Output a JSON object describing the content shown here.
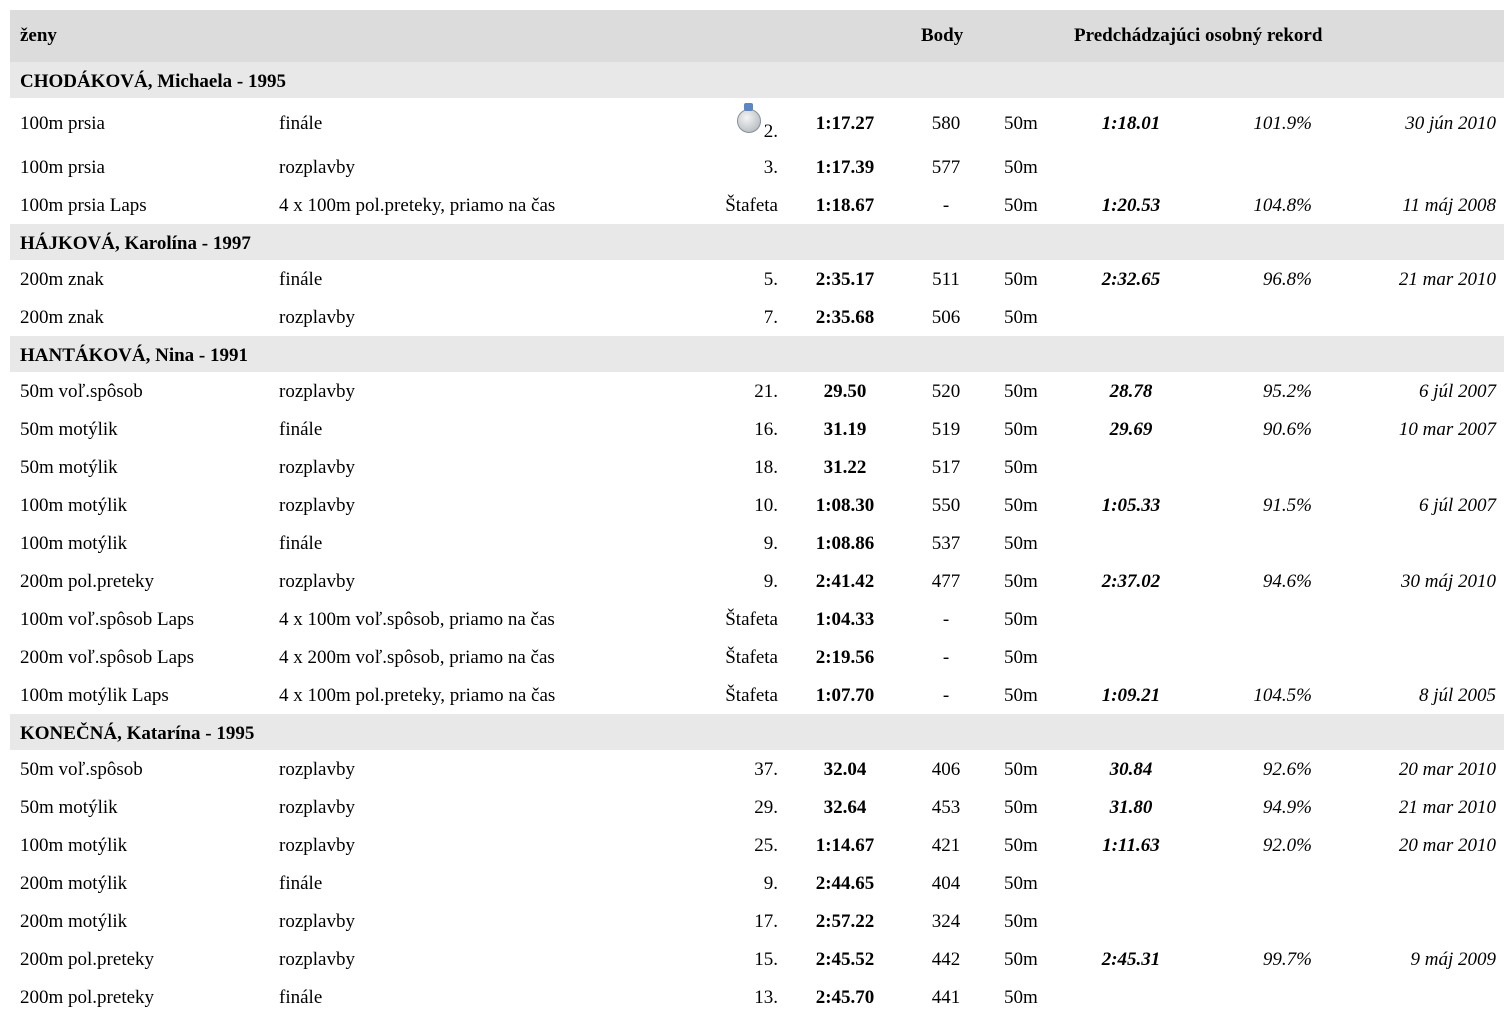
{
  "header": {
    "gender": "ženy",
    "points": "Body",
    "prev_record": "Predchádzajúci osobný rekord"
  },
  "athletes": [
    {
      "name": "CHODÁKOVÁ, Michaela - 1995",
      "results": [
        {
          "event": "100m prsia",
          "round": "finále",
          "place": "2.",
          "medal": "silver-medal",
          "time": "1:17.27",
          "points": "580",
          "pool": "50m",
          "prev": "1:18.01",
          "pct": "101.9%",
          "date": "30 jún 2010"
        },
        {
          "event": "100m prsia",
          "round": "rozplavby",
          "place": "3.",
          "time": "1:17.39",
          "points": "577",
          "pool": "50m",
          "prev": "",
          "pct": "",
          "date": ""
        },
        {
          "event": "100m prsia Laps",
          "round": "4 x 100m pol.preteky, priamo na čas",
          "place": "Štafeta",
          "time": "1:18.67",
          "points": "-",
          "pool": "50m",
          "prev": "1:20.53",
          "pct": "104.8%",
          "date": "11 máj 2008"
        }
      ]
    },
    {
      "name": "HÁJKOVÁ, Karolína - 1997",
      "results": [
        {
          "event": "200m znak",
          "round": "finále",
          "place": "5.",
          "time": "2:35.17",
          "points": "511",
          "pool": "50m",
          "prev": "2:32.65",
          "pct": "96.8%",
          "date": "21 mar 2010"
        },
        {
          "event": "200m znak",
          "round": "rozplavby",
          "place": "7.",
          "time": "2:35.68",
          "points": "506",
          "pool": "50m",
          "prev": "",
          "pct": "",
          "date": ""
        }
      ]
    },
    {
      "name": "HANTÁKOVÁ, Nina - 1991",
      "results": [
        {
          "event": "50m voľ.spôsob",
          "round": "rozplavby",
          "place": "21.",
          "time": "29.50",
          "points": "520",
          "pool": "50m",
          "prev": "28.78",
          "pct": "95.2%",
          "date": "6 júl 2007"
        },
        {
          "event": "50m motýlik",
          "round": "finále",
          "place": "16.",
          "time": "31.19",
          "points": "519",
          "pool": "50m",
          "prev": "29.69",
          "pct": "90.6%",
          "date": "10 mar 2007"
        },
        {
          "event": "50m motýlik",
          "round": "rozplavby",
          "place": "18.",
          "time": "31.22",
          "points": "517",
          "pool": "50m",
          "prev": "",
          "pct": "",
          "date": ""
        },
        {
          "event": "100m motýlik",
          "round": "rozplavby",
          "place": "10.",
          "time": "1:08.30",
          "points": "550",
          "pool": "50m",
          "prev": "1:05.33",
          "pct": "91.5%",
          "date": "6 júl 2007"
        },
        {
          "event": "100m motýlik",
          "round": "finále",
          "place": "9.",
          "time": "1:08.86",
          "points": "537",
          "pool": "50m",
          "prev": "",
          "pct": "",
          "date": ""
        },
        {
          "event": "200m pol.preteky",
          "round": "rozplavby",
          "place": "9.",
          "time": "2:41.42",
          "points": "477",
          "pool": "50m",
          "prev": "2:37.02",
          "pct": "94.6%",
          "date": "30 máj 2010"
        },
        {
          "event": "100m voľ.spôsob Laps",
          "round": "4 x 100m voľ.spôsob, priamo na čas",
          "place": "Štafeta",
          "time": "1:04.33",
          "points": "-",
          "pool": "50m",
          "prev": "",
          "pct": "",
          "date": ""
        },
        {
          "event": "200m voľ.spôsob Laps",
          "round": "4 x 200m voľ.spôsob, priamo na čas",
          "place": "Štafeta",
          "time": "2:19.56",
          "points": "-",
          "pool": "50m",
          "prev": "",
          "pct": "",
          "date": ""
        },
        {
          "event": "100m motýlik Laps",
          "round": "4 x 100m pol.preteky, priamo na čas",
          "place": "Štafeta",
          "time": "1:07.70",
          "points": "-",
          "pool": "50m",
          "prev": "1:09.21",
          "pct": "104.5%",
          "date": "8 júl 2005"
        }
      ]
    },
    {
      "name": "KONEČNÁ, Katarína - 1995",
      "results": [
        {
          "event": "50m voľ.spôsob",
          "round": "rozplavby",
          "place": "37.",
          "time": "32.04",
          "points": "406",
          "pool": "50m",
          "prev": "30.84",
          "pct": "92.6%",
          "date": "20 mar 2010"
        },
        {
          "event": "50m motýlik",
          "round": "rozplavby",
          "place": "29.",
          "time": "32.64",
          "points": "453",
          "pool": "50m",
          "prev": "31.80",
          "pct": "94.9%",
          "date": "21 mar 2010"
        },
        {
          "event": "100m motýlik",
          "round": "rozplavby",
          "place": "25.",
          "time": "1:14.67",
          "points": "421",
          "pool": "50m",
          "prev": "1:11.63",
          "pct": "92.0%",
          "date": "20 mar 2010"
        },
        {
          "event": "200m motýlik",
          "round": "finále",
          "place": "9.",
          "time": "2:44.65",
          "points": "404",
          "pool": "50m",
          "prev": "",
          "pct": "",
          "date": ""
        },
        {
          "event": "200m motýlik",
          "round": "rozplavby",
          "place": "17.",
          "time": "2:57.22",
          "points": "324",
          "pool": "50m",
          "prev": "",
          "pct": "",
          "date": ""
        },
        {
          "event": "200m pol.preteky",
          "round": "rozplavby",
          "place": "15.",
          "time": "2:45.52",
          "points": "442",
          "pool": "50m",
          "prev": "2:45.31",
          "pct": "99.7%",
          "date": "9 máj 2009"
        },
        {
          "event": "200m pol.preteky",
          "round": "finále",
          "place": "13.",
          "time": "2:45.70",
          "points": "441",
          "pool": "50m",
          "prev": "",
          "pct": "",
          "date": ""
        }
      ]
    }
  ]
}
